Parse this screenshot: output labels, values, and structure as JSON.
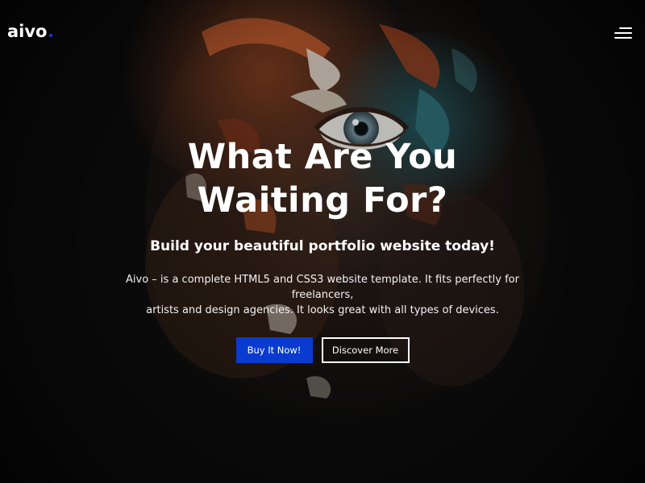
{
  "header": {
    "logo_text": "aivo",
    "logo_dot_color": "#1a3fd6",
    "menu_icon": "hamburger-menu-icon"
  },
  "hero": {
    "title_line1": "What Are You",
    "title_line2": "Waiting For?",
    "subtitle": "Build your beautiful portfolio website today!",
    "description_line1": "Aivo – is a complete HTML5 and CSS3 website template. It fits perfectly for freelancers,",
    "description_line2": "artists and design agencies. It looks great with all types of devices.",
    "background_image": "painted-face-portrait-photo"
  },
  "buttons": {
    "primary_label": "Buy It Now!",
    "primary_color": "#0a3bd0",
    "secondary_label": "Discover More"
  }
}
